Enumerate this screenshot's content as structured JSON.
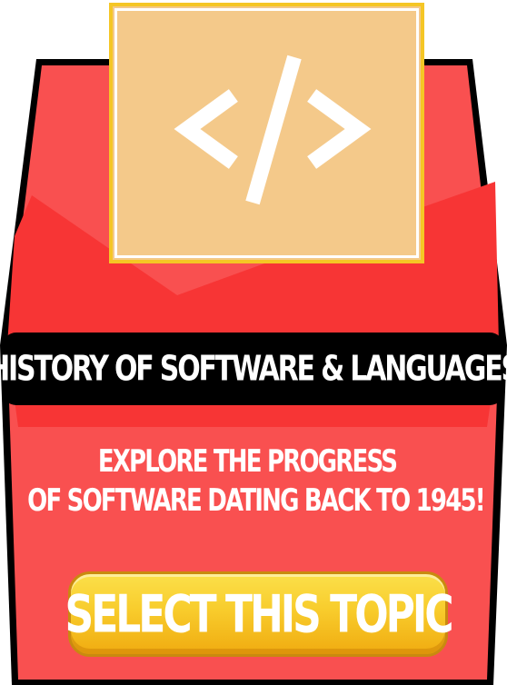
{
  "card": {
    "icon": "code-brackets-icon",
    "icon_symbol": "</>",
    "title": "HISTORY OF SOFTWARE & LANGUAGES",
    "description": {
      "line1": "EXPLORE THE PROGRESS",
      "line2": "OF SOFTWARE DATING BACK TO 1945!"
    },
    "cta_label": "SELECT THIS TOPIC"
  },
  "colors": {
    "card_red": "#f95050",
    "card_red_dark": "#f73535",
    "tile_fill": "#f4c98a",
    "tile_border": "#f5c625",
    "title_bar": "#000000",
    "cta_gold": "#f8cc2c"
  }
}
